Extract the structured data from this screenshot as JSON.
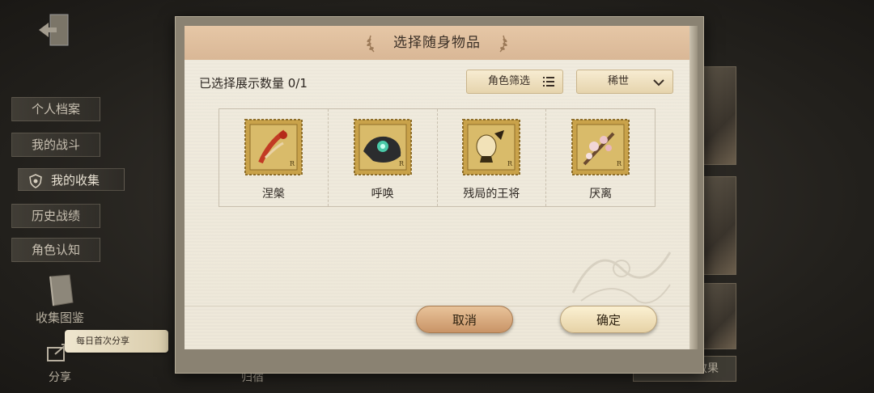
{
  "sidebar": {
    "items": [
      {
        "label": "个人档案"
      },
      {
        "label": "我的战斗"
      },
      {
        "label": "我的收集"
      },
      {
        "label": "历史战绩"
      },
      {
        "label": "角色认知"
      }
    ],
    "collection_label": "收集图鉴",
    "share_badge": "每日首次分享",
    "share_label": "分享"
  },
  "background": {
    "edit_display": "编辑展示效果",
    "bottom_label": "归宿"
  },
  "dialog": {
    "title": "选择随身物品",
    "selected_count": "已选择展示数量 0/1",
    "filter_button": "角色筛选",
    "rarity_select": "稀世",
    "items": [
      {
        "name": "涅槃",
        "icon": "phoenix-feather-stamp"
      },
      {
        "name": "呼唤",
        "icon": "dark-orb-stamp"
      },
      {
        "name": "残局的王将",
        "icon": "chess-king-stamp"
      },
      {
        "name": "厌离",
        "icon": "sakura-branch-stamp"
      }
    ],
    "cancel_label": "取消",
    "confirm_label": "确定"
  },
  "colors": {
    "title_bar": "#dcbc9b",
    "parchment": "#eee8d9",
    "cancel_button": "#d6a577",
    "confirm_button": "#f2e3bd",
    "stamp_gold": "#c9a24a"
  }
}
